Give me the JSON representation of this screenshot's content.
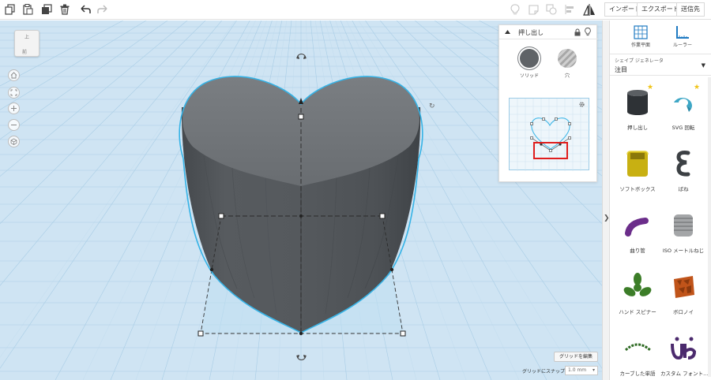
{
  "toolbar": {
    "left_icons": [
      "copy-icon",
      "paste-icon",
      "duplicate-icon",
      "delete-icon",
      "undo-icon",
      "redo-icon"
    ],
    "right_icons": [
      "lightbulb-icon",
      "note-icon",
      "group-icon",
      "align-icon",
      "mirror-icon"
    ],
    "import_label": "インポート",
    "export_label": "エクスポート",
    "send_label": "送信先"
  },
  "viewcube": {
    "top_label": "上",
    "front_label": "前"
  },
  "view_controls": [
    "home-icon",
    "fit-icon",
    "zoom-in-icon",
    "zoom-out-icon",
    "perspective-icon"
  ],
  "inspector": {
    "title": "押し出し",
    "solid_label": "ソリッド",
    "hole_label": "穴"
  },
  "grid": {
    "edit_label": "グリッドを編集",
    "snap_label": "グリッドにスナップ",
    "snap_value": "1.0 mm"
  },
  "sidebar": {
    "workplane_label": "作業平面",
    "ruler_label": "ルーラー",
    "library_title": "シェイプ ジェネレータ",
    "library_value": "注目",
    "shapes": [
      {
        "name": "押し出し",
        "starred": true
      },
      {
        "name": "SVG 回転",
        "starred": true
      },
      {
        "name": "ソフトボックス",
        "starred": false
      },
      {
        "name": "ばね",
        "starred": false
      },
      {
        "name": "曲り管",
        "starred": false
      },
      {
        "name": "ISO メートルねじ",
        "starred": false
      },
      {
        "name": "ハンド スピナー",
        "starred": false
      },
      {
        "name": "ボロノイ",
        "starred": false
      },
      {
        "name": "カーブした単語",
        "starred": false
      },
      {
        "name": "カスタム フォント...",
        "starred": false
      }
    ]
  },
  "colors": {
    "workplane": "#cfe4f3",
    "grid_line": "#a9cde6",
    "shape_body": "#5f6367",
    "selection_outline": "#36b3e6",
    "highlight_box": "#e01e1e"
  }
}
